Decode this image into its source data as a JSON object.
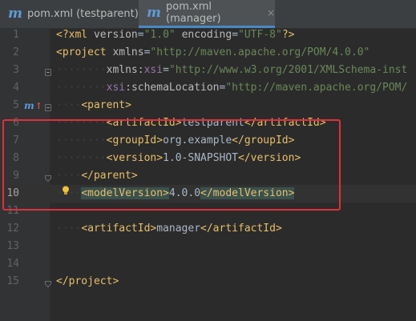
{
  "tabs": [
    {
      "label": "pom.xml (testparent)",
      "icon": "maven-file-icon",
      "active": false
    },
    {
      "label": "pom.xml (manager)",
      "icon": "maven-file-icon",
      "active": true
    }
  ],
  "close_glyph": "×",
  "gutter": {
    "maven_mark": "m",
    "maven_arrow": "↑"
  },
  "lines": [
    {
      "n": "1",
      "parts": [
        [
          "tag",
          "<?xml "
        ],
        [
          "attr",
          "version"
        ],
        [
          "txt",
          "="
        ],
        [
          "str",
          "\"1.0\""
        ],
        [
          "txt",
          " "
        ],
        [
          "attr",
          "encoding"
        ],
        [
          "txt",
          "="
        ],
        [
          "str",
          "\"UTF-8\""
        ],
        [
          "tag",
          "?>"
        ]
      ]
    },
    {
      "n": "2",
      "parts": [
        [
          "tag",
          "<project "
        ],
        [
          "attr",
          "xmlns"
        ],
        [
          "txt",
          "="
        ],
        [
          "str",
          "\"http://maven.apache.org/POM/4.0.0\""
        ]
      ]
    },
    {
      "n": "3",
      "parts": [
        [
          "ws",
          "········"
        ],
        [
          "attr",
          "xmlns"
        ],
        [
          "txt",
          ":"
        ],
        [
          "ns",
          "xsi"
        ],
        [
          "txt",
          "="
        ],
        [
          "str",
          "\"http://www.w3.org/2001/XMLSchema-inst"
        ]
      ]
    },
    {
      "n": "4",
      "parts": [
        [
          "ws",
          "········"
        ],
        [
          "ns",
          "xsi"
        ],
        [
          "txt",
          ":"
        ],
        [
          "attr",
          "schemaLocation"
        ],
        [
          "txt",
          "="
        ],
        [
          "str",
          "\"http://maven.apache.org/POM/"
        ]
      ]
    },
    {
      "n": "5",
      "parts": [
        [
          "ws",
          "····"
        ],
        [
          "tag",
          "<parent>"
        ]
      ]
    },
    {
      "n": "6",
      "parts": [
        [
          "ws",
          "········"
        ],
        [
          "tag",
          "<artifactId>"
        ],
        [
          "txt",
          "testparent"
        ],
        [
          "tag",
          "</artifactId>"
        ]
      ]
    },
    {
      "n": "7",
      "parts": [
        [
          "ws",
          "········"
        ],
        [
          "tag",
          "<groupId>"
        ],
        [
          "txt",
          "org.example"
        ],
        [
          "tag",
          "</groupId>"
        ]
      ]
    },
    {
      "n": "8",
      "parts": [
        [
          "ws",
          "········"
        ],
        [
          "tag",
          "<version>"
        ],
        [
          "txt",
          "1.0-SNAPSHOT"
        ],
        [
          "tag",
          "</version>"
        ]
      ]
    },
    {
      "n": "9",
      "parts": [
        [
          "ws",
          "····"
        ],
        [
          "tag",
          "</parent>"
        ]
      ]
    },
    {
      "n": "10",
      "parts": [
        [
          "ws",
          "····"
        ],
        [
          "tag hl",
          "<modelVersion>"
        ],
        [
          "txt",
          "4.0.0"
        ],
        [
          "tag hl",
          "</modelVersion>"
        ]
      ]
    },
    {
      "n": "11",
      "parts": []
    },
    {
      "n": "12",
      "parts": [
        [
          "ws",
          "····"
        ],
        [
          "tag",
          "<artifactId>"
        ],
        [
          "txt",
          "manager"
        ],
        [
          "tag",
          "</artifactId>"
        ]
      ]
    },
    {
      "n": "13",
      "parts": []
    },
    {
      "n": "14",
      "parts": []
    },
    {
      "n": "15",
      "parts": [
        [
          "tag",
          "</project>"
        ]
      ]
    }
  ],
  "colors": {
    "background": "#2b2b2b",
    "tag": "#e8bf6a",
    "string": "#6a8759",
    "namespace": "#9876aa",
    "highlight_box": "#e0303a",
    "active_tab_underline": "#4a88c7"
  }
}
